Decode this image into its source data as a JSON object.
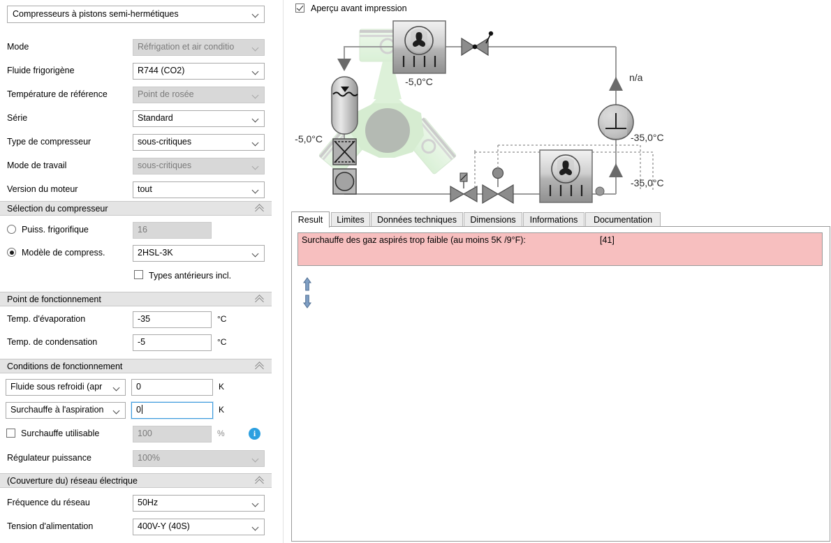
{
  "left_panel": {
    "category_combo": {
      "value": "Compresseurs à pistons semi-hermétiques",
      "icon": "chevron-down-icon"
    },
    "fields": [
      {
        "label": "Mode",
        "value": "Réfrigation et air conditio",
        "disabled": true,
        "unit": ""
      },
      {
        "label": "Fluide frigorigène",
        "value": "R744 (CO2)",
        "disabled": false,
        "unit": ""
      },
      {
        "label": "Température de référence",
        "value": "Point de rosée",
        "disabled": true,
        "unit": ""
      },
      {
        "label": "Série",
        "value": "Standard",
        "disabled": false,
        "unit": ""
      },
      {
        "label": "Type de compresseur",
        "value": "sous-critiques",
        "disabled": false,
        "unit": ""
      },
      {
        "label": "Mode de travail",
        "value": "sous-critiques",
        "disabled": true,
        "unit": ""
      },
      {
        "label": "Version du moteur",
        "value": "tout",
        "disabled": false,
        "unit": ""
      }
    ],
    "sections": {
      "selection": {
        "title": "Sélection du compresseur",
        "collapse_icon": "double-chevron-up-icon",
        "radio_capacity": {
          "label": "Puiss. frigorifique",
          "selected": false,
          "value": "16",
          "disabled": true
        },
        "radio_model": {
          "label": "Modèle de compress.",
          "selected": true,
          "value": "2HSL-3K",
          "disabled": false
        },
        "checkbox_previous": {
          "label": "Types antérieurs incl.",
          "checked": false
        }
      },
      "operating_point": {
        "title": "Point de fonctionnement",
        "collapse_icon": "double-chevron-up-icon",
        "rows": [
          {
            "label": "Temp. d'évaporation",
            "value": "-35",
            "unit": "°C"
          },
          {
            "label": "Temp. de condensation",
            "value": "-5",
            "unit": "°C"
          }
        ]
      },
      "operating_conditions": {
        "title": "Conditions de fonctionnement",
        "collapse_icon": "double-chevron-up-icon",
        "subcool": {
          "selector": "Fluide sous refroidi (apr",
          "value": "0",
          "unit": "K"
        },
        "superheat": {
          "selector": "Surchauffe à l'aspiration",
          "value": "0",
          "unit": "K",
          "focused": true
        },
        "useful_superheat": {
          "label": "Surchauffe utilisable",
          "checked": false,
          "value": "100",
          "unit": "%",
          "disabled": true,
          "info_icon": "info-icon"
        },
        "capacity_regulator": {
          "label": "Régulateur puissance",
          "value": "100%",
          "disabled": true
        }
      },
      "power_supply": {
        "title": "(Couverture du) réseau électrique",
        "collapse_icon": "double-chevron-up-icon",
        "rows": [
          {
            "label": "Fréquence du réseau",
            "value": "50Hz"
          },
          {
            "label": "Tension d'alimentation",
            "value": "400V-Y (40S)"
          }
        ]
      }
    }
  },
  "right_panel": {
    "print_preview": {
      "label": "Aperçu avant impression",
      "checked": true
    },
    "diagram": {
      "type": "refrigeration-circuit-schematic",
      "labels": [
        {
          "name": "condenser-temp",
          "text": "-5,0°C"
        },
        {
          "name": "receiver-temp",
          "text": "-5,0°C"
        },
        {
          "name": "compressor-power",
          "text": "n/a"
        },
        {
          "name": "suction-temp-upper",
          "text": "-35,0°C"
        },
        {
          "name": "suction-temp-lower",
          "text": "-35,0°C"
        },
        {
          "name": "evaporator-temp",
          "text": "-35,0°C"
        }
      ],
      "components": [
        "condenser-with-fan",
        "check-valve",
        "receiver-vessel",
        "filter-drier",
        "sight-glass",
        "expansion-valve",
        "solenoid-valve",
        "evaporator-with-fan",
        "compressor",
        "sensor-bulb"
      ]
    },
    "tabs": [
      {
        "label": "Result",
        "active": true
      },
      {
        "label": "Limites",
        "active": false
      },
      {
        "label": "Données techniques",
        "active": false
      },
      {
        "label": "Dimensions",
        "active": false
      },
      {
        "label": "Informations",
        "active": false
      },
      {
        "label": "Documentation",
        "active": false
      }
    ],
    "message": {
      "text": "Surchauffe des gaz aspirés trop faible (au moins 5K /9°F):",
      "code": "[41]",
      "background": "#f7bfbf"
    },
    "nav": {
      "up_icon": "arrow-up-icon",
      "down_icon": "arrow-down-icon"
    }
  },
  "colors": {
    "section_header": "#e4e4e4",
    "disabled_field": "#d8d8d8",
    "error_bg": "#f7bfbf",
    "focus_border": "#3c9bdd",
    "info_blue": "#2da0e0"
  }
}
